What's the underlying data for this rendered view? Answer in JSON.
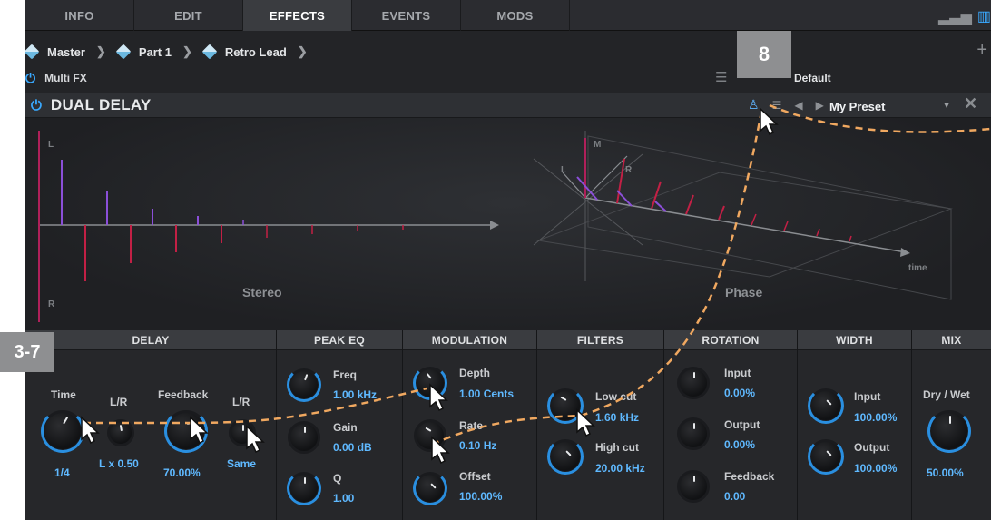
{
  "tabs": [
    {
      "label": "INFO",
      "active": false
    },
    {
      "label": "EDIT",
      "active": false
    },
    {
      "label": "EFFECTS",
      "active": true
    },
    {
      "label": "EVENTS",
      "active": false
    },
    {
      "label": "MODS",
      "active": false
    }
  ],
  "breadcrumb": [
    "Master",
    "Part 1",
    "Retro Lead"
  ],
  "multi_fx": {
    "label": "Multi FX",
    "preset": "Default"
  },
  "effect": {
    "title": "DUAL DELAY",
    "preset": "My Preset"
  },
  "visual": {
    "left_label": "Stereo",
    "right_label": "Phase",
    "axis_L": "L",
    "axis_R": "R",
    "axis_M": "M",
    "axis_time": "time"
  },
  "sections": {
    "delay": {
      "header": "DELAY",
      "time_label": "Time",
      "time_value": "1/4",
      "lr1_label": "L/R",
      "lr1_value": "L x 0.50",
      "feedback_label": "Feedback",
      "feedback_value": "70.00%",
      "lr2_label": "L/R",
      "lr2_value": "Same"
    },
    "peak_eq": {
      "header": "PEAK EQ",
      "freq_label": "Freq",
      "freq_value": "1.00 kHz",
      "gain_label": "Gain",
      "gain_value": "0.00 dB",
      "q_label": "Q",
      "q_value": "1.00"
    },
    "modulation": {
      "header": "MODULATION",
      "depth_label": "Depth",
      "depth_value": "1.00 Cents",
      "rate_label": "Rate",
      "rate_value": "0.10 Hz",
      "offset_label": "Offset",
      "offset_value": "100.00%"
    },
    "filters": {
      "header": "FILTERS",
      "lowcut_label": "Low cut",
      "lowcut_value": "1.60 kHz",
      "highcut_label": "High cut",
      "highcut_value": "20.00 kHz"
    },
    "rotation": {
      "header": "ROTATION",
      "input_label": "Input",
      "input_value": "0.00%",
      "output_label": "Output",
      "output_value": "0.00%",
      "feedback_label": "Feedback",
      "feedback_value": "0.00"
    },
    "width": {
      "header": "WIDTH",
      "input_label": "Input",
      "input_value": "100.00%",
      "output_label": "Output",
      "output_value": "100.00%"
    },
    "mix": {
      "header": "MIX",
      "drywet_label": "Dry / Wet",
      "drywet_value": "50.00%"
    }
  },
  "annotations": {
    "badge_left": "3-7",
    "badge_top": "8"
  },
  "colors": {
    "accent": "#39a9ff",
    "value_text": "#5fb9ff",
    "callout_line": "#f0a860",
    "badge": "#8e8f91"
  }
}
